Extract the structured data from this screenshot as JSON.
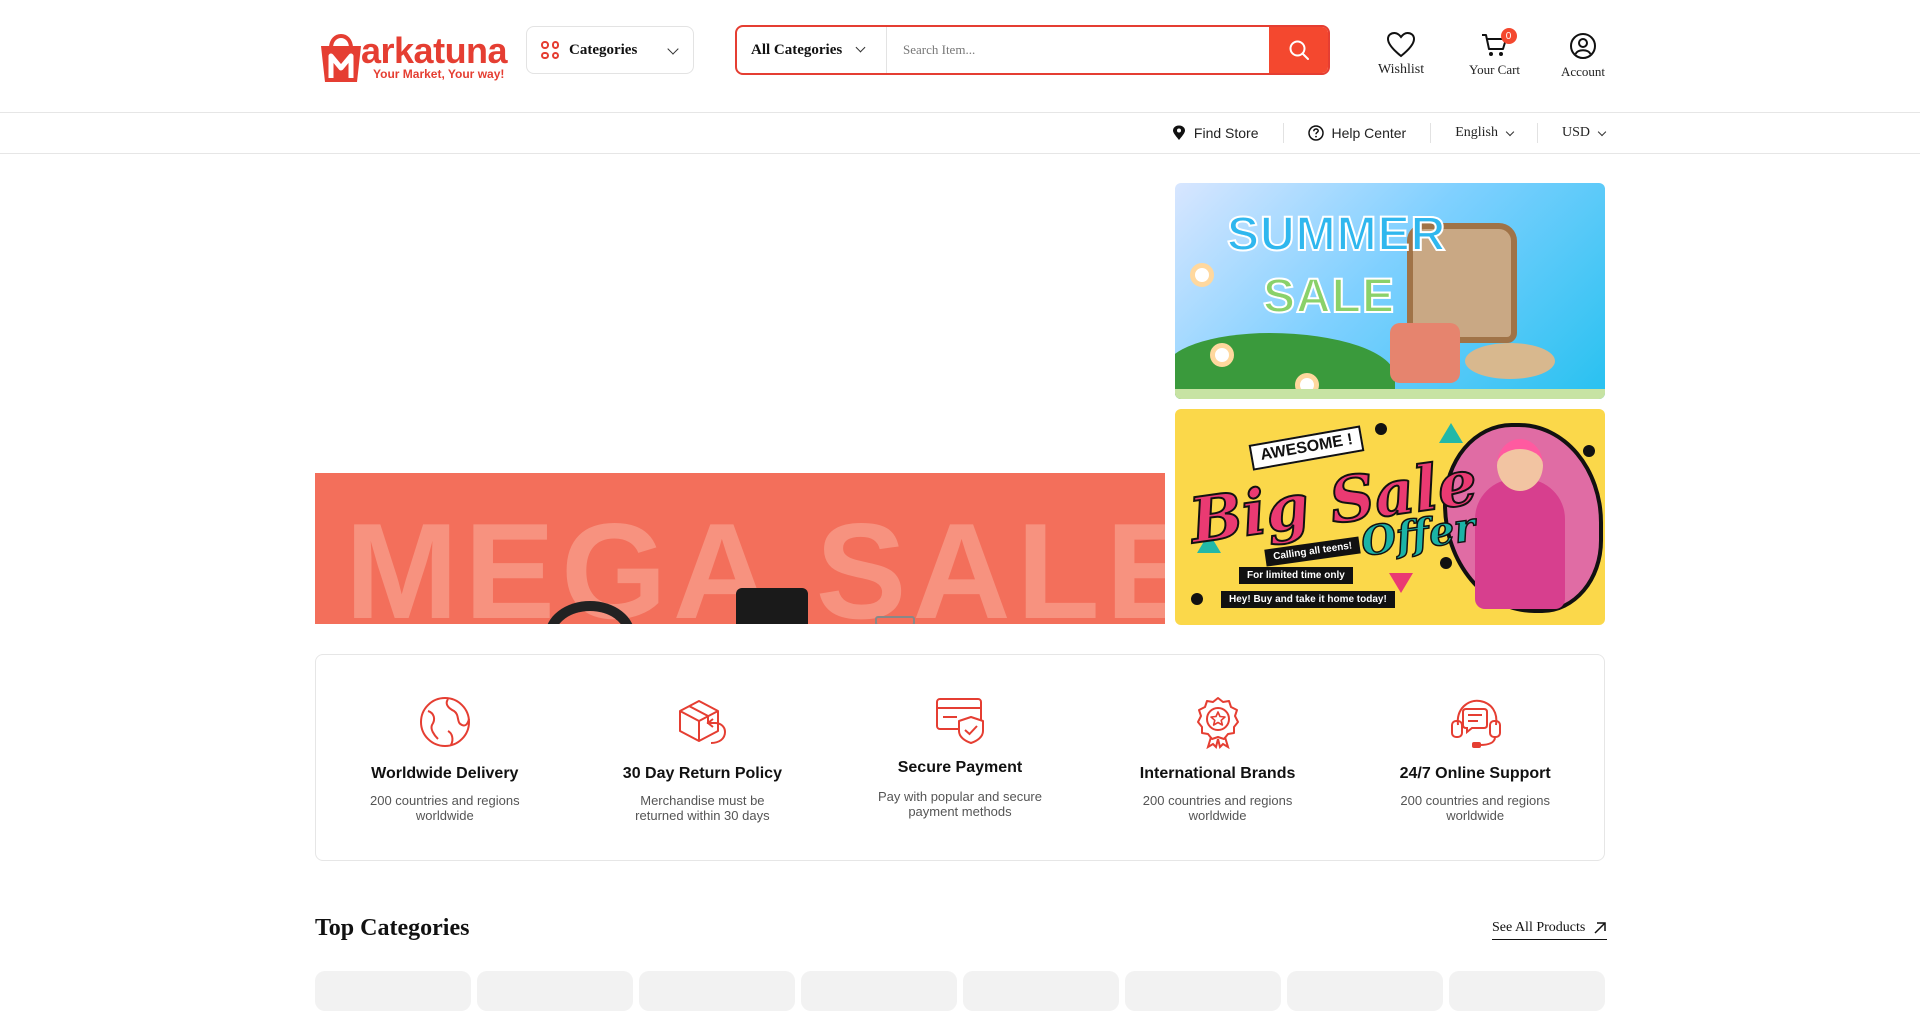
{
  "brand": {
    "name": "arkatuna",
    "tagline": "Your Market, Your way!",
    "accent": "#e53e32",
    "accent_button": "#f4482f"
  },
  "header": {
    "categories_label": "Categories",
    "search": {
      "category_label": "All Categories",
      "placeholder": "Search Item...",
      "value": ""
    },
    "wishlist_label": "Wishlist",
    "cart_label": "Your Cart",
    "cart_count": "0",
    "account_label": "Account"
  },
  "subbar": {
    "find_store": "Find Store",
    "help_center": "Help Center",
    "language": "English",
    "currency": "USD"
  },
  "hero": {
    "main_text": "MEGA SALE",
    "summer_line1": "SUMMER",
    "summer_line2": "SALE",
    "big_sale_awesome": "AWESOME !",
    "big_sale_big": "Big Sale",
    "big_sale_offer": "Offer",
    "big_sale_pill1": "Calling all teens!",
    "big_sale_pill2": "For limited time only",
    "big_sale_pill3": "Hey! Buy and take it home today!"
  },
  "features": [
    {
      "icon": "globe-icon",
      "title": "Worldwide Delivery",
      "desc": "200 countries and regions worldwide"
    },
    {
      "icon": "return-box-icon",
      "title": "30 Day Return Policy",
      "desc": "Merchandise must be returned within 30 days"
    },
    {
      "icon": "secure-card-icon",
      "title": "Secure Payment",
      "desc": "Pay with popular and secure payment methods"
    },
    {
      "icon": "badge-star-icon",
      "title": "International Brands",
      "desc": "200 countries and regions worldwide"
    },
    {
      "icon": "headset-icon",
      "title": "24/7 Online Support",
      "desc": "200 countries and regions worldwide"
    }
  ],
  "top_categories": {
    "title": "Top Categories",
    "see_all": "See All Products"
  }
}
